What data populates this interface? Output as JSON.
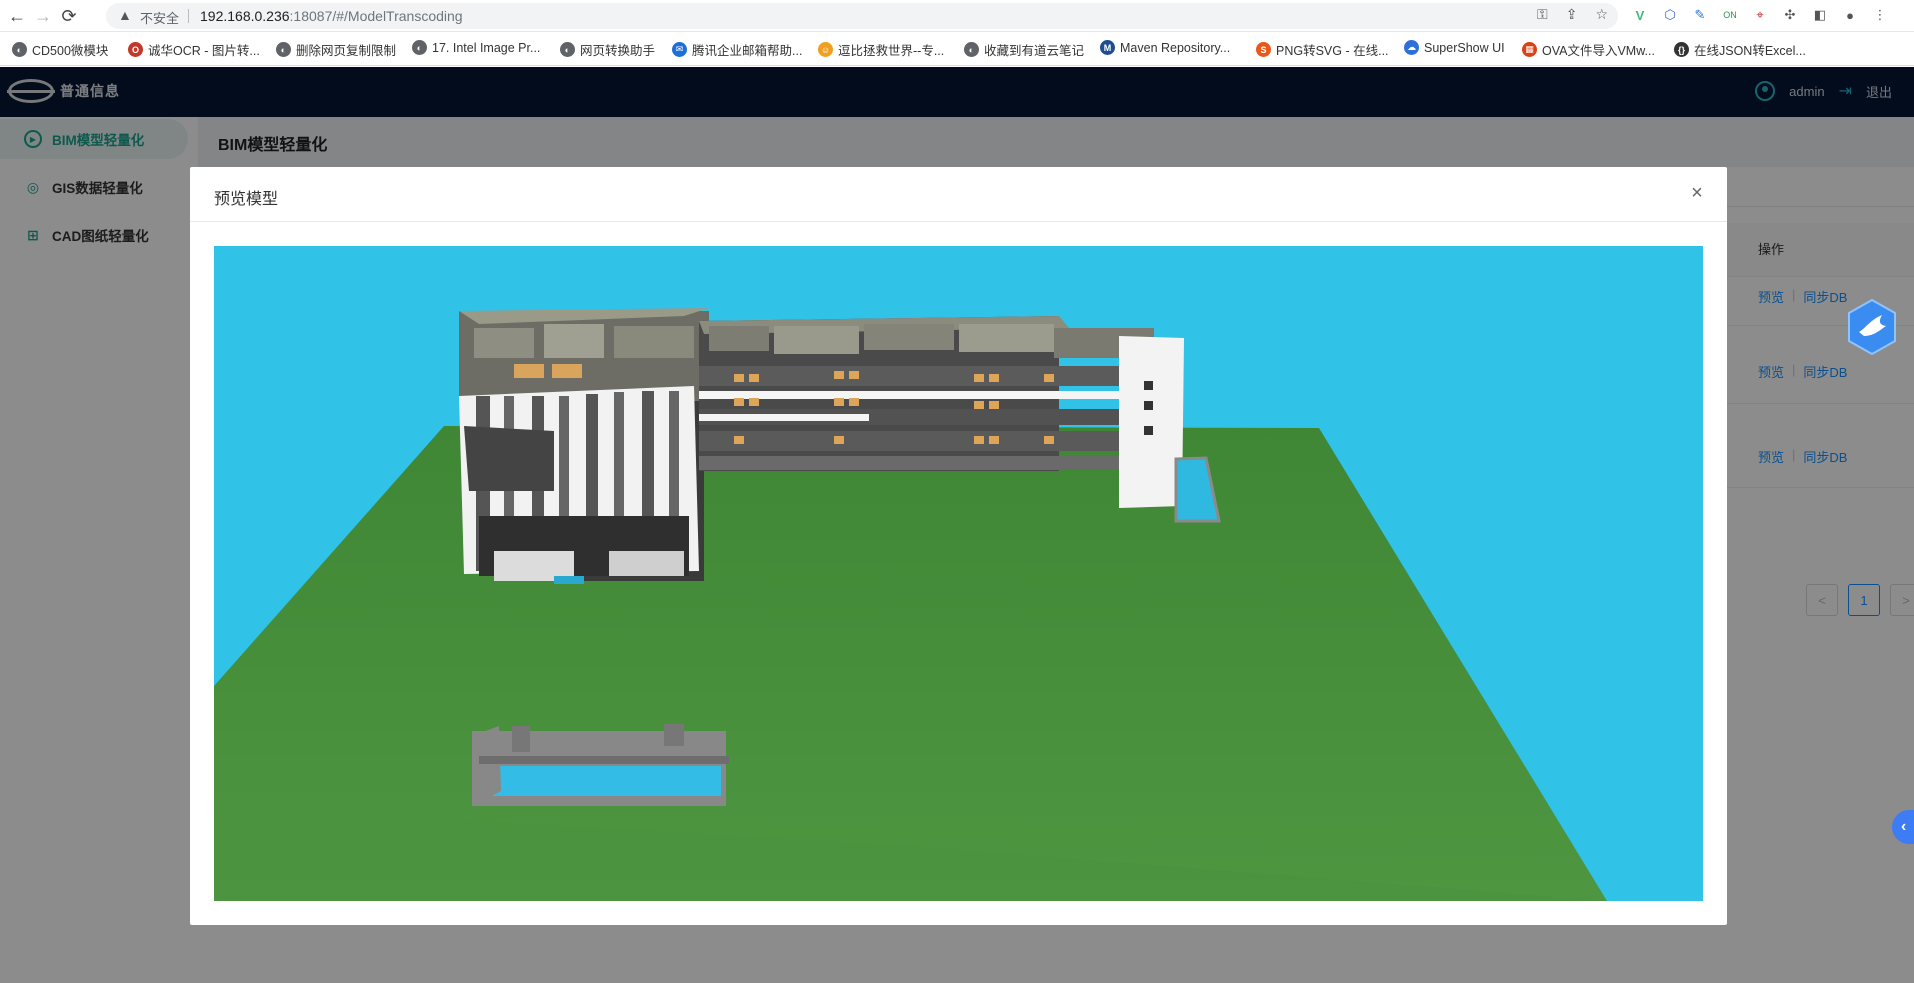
{
  "browser": {
    "nav_back": "←",
    "nav_forward": "→",
    "nav_reload": "⟳",
    "security_label": "不安全",
    "url_host": "192.168.0.236",
    "url_rest": ":18087/#/ModelTranscoding",
    "bookmarks": [
      {
        "label": "CD500微模块",
        "icon": "globe-icon",
        "color": "#5f6368"
      },
      {
        "label": "诚华OCR - 图片转...",
        "icon": "ocr-icon",
        "color": "#c0392b"
      },
      {
        "label": "删除网页复制限制",
        "icon": "globe-icon",
        "color": "#5f6368"
      },
      {
        "label": "17. Intel Image Pr...",
        "icon": "globe-icon",
        "color": "#5f6368"
      },
      {
        "label": "网页转换助手",
        "icon": "globe-icon",
        "color": "#5f6368"
      },
      {
        "label": "腾讯企业邮箱帮助...",
        "icon": "mail-icon",
        "color": "#1e6fd9"
      },
      {
        "label": "逗比拯救世界--专...",
        "icon": "smile-icon",
        "color": "#f0a020"
      },
      {
        "label": "收藏到有道云笔记",
        "icon": "globe-icon",
        "color": "#5f6368"
      },
      {
        "label": "Maven Repository...",
        "icon": "maven-icon",
        "color": "#1f4e8c"
      },
      {
        "label": "PNG转SVG - 在线...",
        "icon": "png-icon",
        "color": "#e55a1c"
      },
      {
        "label": "SuperShow UI",
        "icon": "cloud-icon",
        "color": "#2e6fd9"
      },
      {
        "label": "OVA文件导入VMw...",
        "icon": "ova-icon",
        "color": "#d84315"
      },
      {
        "label": "在线JSON转Excel...",
        "icon": "braces-icon",
        "color": "#333333"
      }
    ]
  },
  "app": {
    "brand": "普通信息",
    "user": "admin",
    "logout": "退出",
    "page_title": "BIM模型轻量化"
  },
  "sidebar": {
    "items": [
      {
        "label": "BIM模型轻量化",
        "icon": "play-circle-icon",
        "active": true
      },
      {
        "label": "GIS数据轻量化",
        "icon": "globe-icon",
        "active": false
      },
      {
        "label": "CAD图纸轻量化",
        "icon": "cad-icon",
        "active": false
      }
    ]
  },
  "table": {
    "op_header": "操作",
    "rows": [
      {
        "preview": "预览",
        "sync": "同步DB"
      },
      {
        "preview": "预览",
        "sync": "同步DB"
      },
      {
        "preview": "预览",
        "sync": "同步DB"
      }
    ]
  },
  "pagination": {
    "prev": "<",
    "current": "1",
    "next": ">"
  },
  "modal": {
    "title": "预览模型",
    "close": "×"
  },
  "colors": {
    "sky": "#31c2e8",
    "ground": "#4a8f3c",
    "accent": "#1aa38e",
    "header_bg": "#061733",
    "link": "#1890ff"
  }
}
